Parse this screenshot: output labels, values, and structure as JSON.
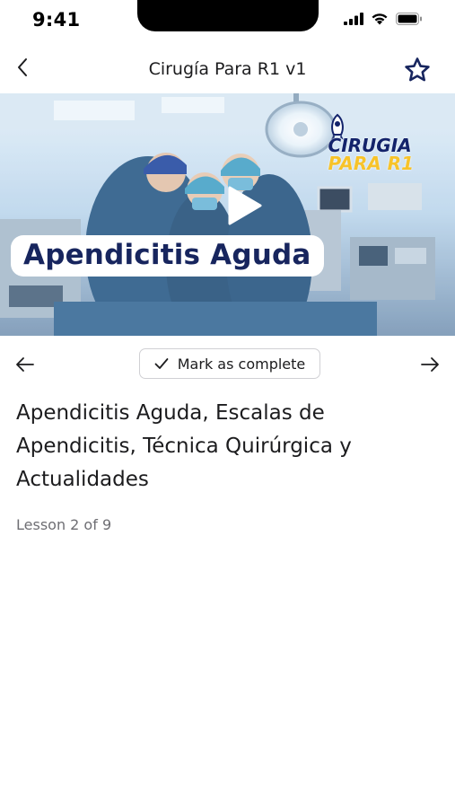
{
  "status_bar": {
    "time": "9:41",
    "icons": [
      "cellular-signal-icon",
      "wifi-icon",
      "battery-icon"
    ]
  },
  "nav": {
    "title": "Cirugía Para R1 v1",
    "back_icon": "chevron-left-icon",
    "favorite_icon": "star-outline-icon"
  },
  "video": {
    "caption": "Apendicitis Aguda",
    "brand_line1": "CIRUGIA",
    "brand_line2": "PARA R1",
    "play_icon": "play-icon"
  },
  "controls": {
    "prev_icon": "arrow-left-icon",
    "next_icon": "arrow-right-icon",
    "mark_complete_label": "Mark as complete",
    "mark_complete_icon": "checkmark-icon"
  },
  "lesson": {
    "title": "Apendicitis Aguda, Escalas de Apendicitis, Técnica Quirúrgica y Actualidades",
    "progress": "Lesson 2 of 9"
  },
  "colors": {
    "accent_navy": "#17255e",
    "brand_yellow": "#f7c32a",
    "text_primary": "#1c1c1e",
    "text_secondary": "#6e6e73"
  }
}
